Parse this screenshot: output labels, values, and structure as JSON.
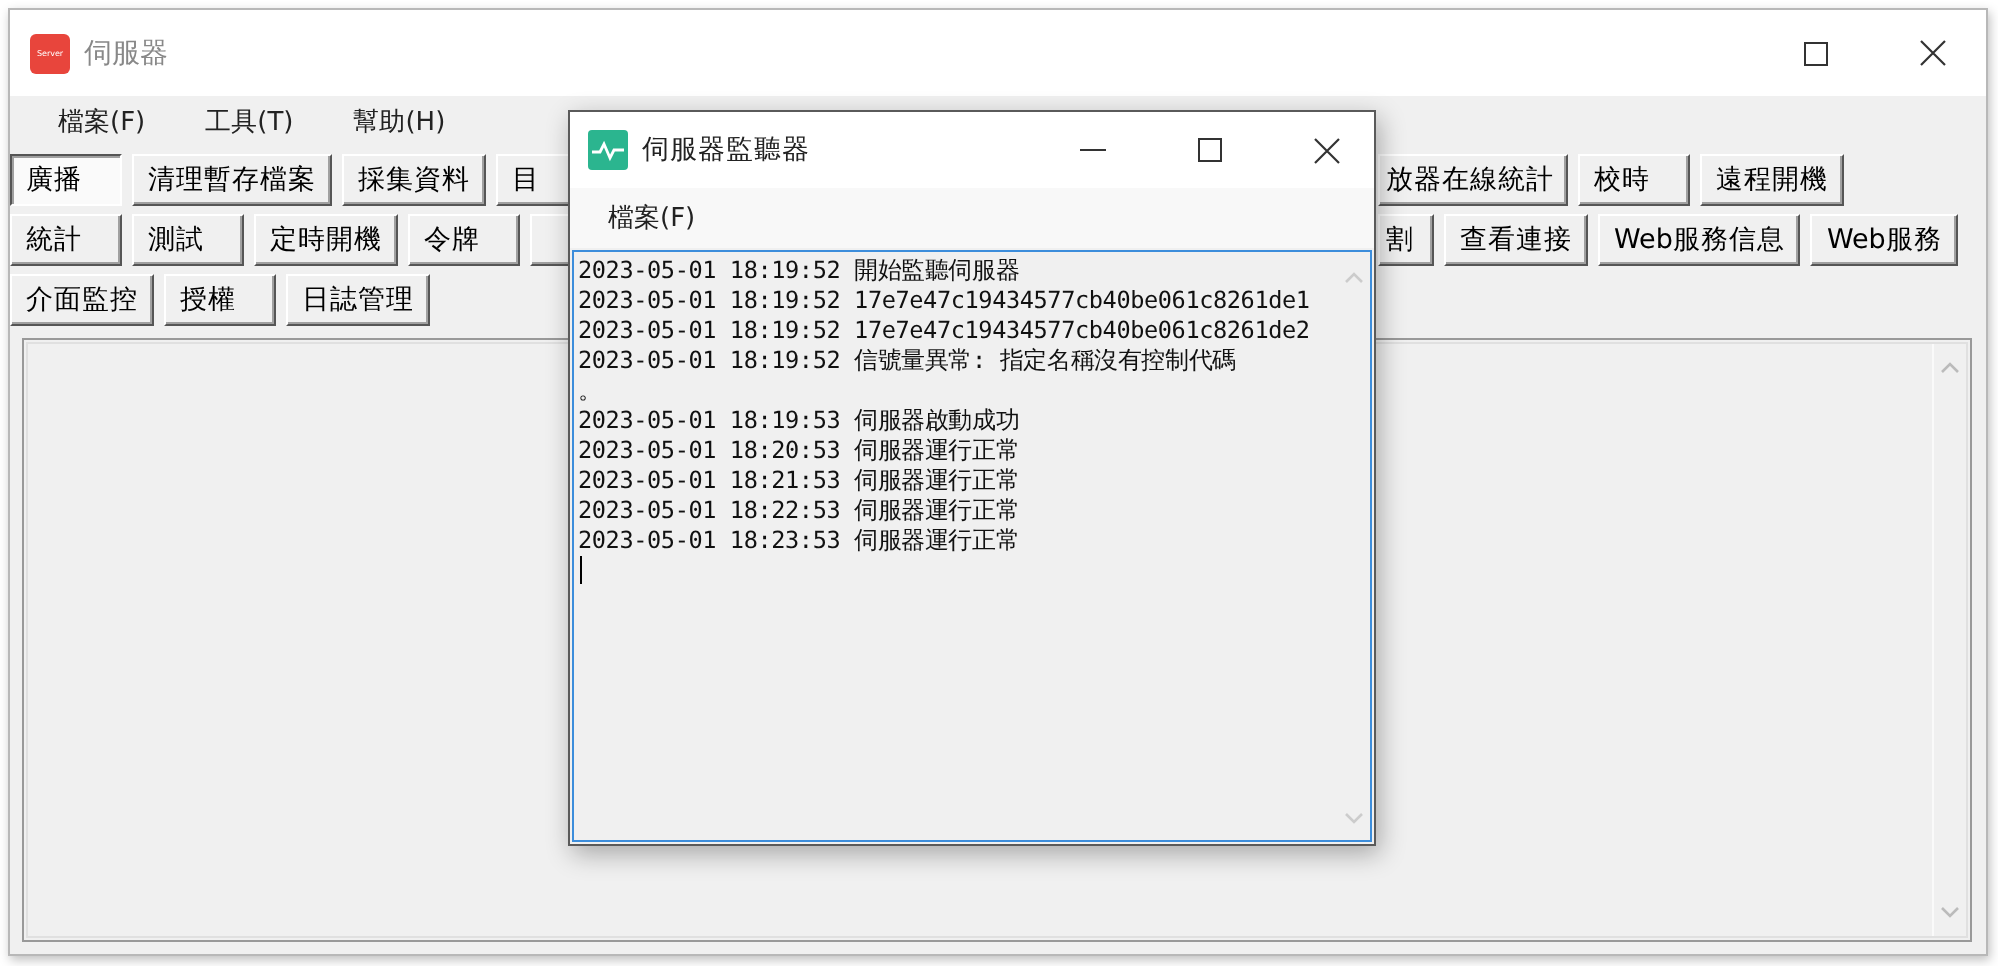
{
  "window": {
    "title": "伺服器",
    "logo_text": "Server"
  },
  "menu": [
    "檔案(F)",
    "工具(T)",
    "幫助(H)"
  ],
  "toolbar_rows": [
    {
      "left": [
        {
          "kind": "button",
          "label": "廣播",
          "selected": true
        },
        {
          "kind": "button",
          "label": "清理暫存檔案",
          "selected": false
        },
        {
          "kind": "button",
          "label": "採集資料",
          "selected": false
        },
        {
          "kind": "button",
          "label": "目",
          "selected": false
        }
      ],
      "right": [
        {
          "kind": "button",
          "label": "放器在線統計",
          "selected": false
        },
        {
          "kind": "button",
          "label": "校時",
          "selected": false
        },
        {
          "kind": "button",
          "label": "遠程開機",
          "selected": false
        }
      ]
    },
    {
      "left": [
        {
          "kind": "button",
          "label": "統計",
          "selected": false
        },
        {
          "kind": "button",
          "label": "測試",
          "selected": false
        },
        {
          "kind": "button",
          "label": "定時開機",
          "selected": false
        },
        {
          "kind": "button",
          "label": "令牌",
          "selected": false
        },
        {
          "kind": "covered",
          "selected": false
        }
      ],
      "right": [
        {
          "kind": "button",
          "label": "割",
          "selected": false
        },
        {
          "kind": "button",
          "label": "查看連接",
          "selected": false
        },
        {
          "kind": "button",
          "label": "Web服務信息",
          "selected": false
        },
        {
          "kind": "button",
          "label": "Web服務",
          "selected": false
        }
      ]
    },
    {
      "left": [
        {
          "kind": "button",
          "label": "介面監控",
          "selected": false
        },
        {
          "kind": "button",
          "label": "授權",
          "selected": false
        },
        {
          "kind": "button",
          "label": "日誌管理",
          "selected": false
        }
      ],
      "right": []
    }
  ],
  "monitor": {
    "title": "伺服器監聽器",
    "menu": [
      "檔案(F)"
    ],
    "log": [
      "2023-05-01 18:19:52 開始監聽伺服器",
      "2023-05-01 18:19:52 17e7e47c19434577cb40be061c8261de1",
      "2023-05-01 18:19:52 17e7e47c19434577cb40be061c8261de2",
      "2023-05-01 18:19:52 信號量異常: 指定名稱沒有控制代碼",
      "。",
      "2023-05-01 18:19:53 伺服器啟動成功",
      "2023-05-01 18:20:53 伺服器運行正常",
      "2023-05-01 18:21:53 伺服器運行正常",
      "2023-05-01 18:22:53 伺服器運行正常",
      "2023-05-01 18:23:53 伺服器運行正常"
    ]
  }
}
